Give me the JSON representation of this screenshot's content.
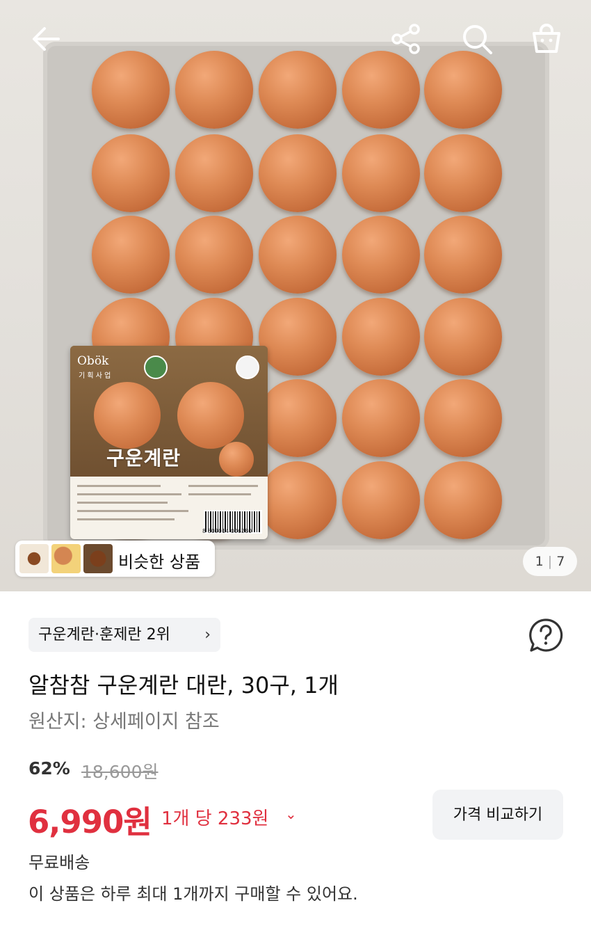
{
  "header": {
    "back_icon": "arrow-left-icon",
    "share_icon": "share-icon",
    "search_icon": "search-icon",
    "cart_icon": "shopping-bag-icon"
  },
  "gallery": {
    "current": "1",
    "total": "7",
    "similar_label": "비슷한 상품",
    "package": {
      "brand": "Obök",
      "brand_sub": "기 획 사 업",
      "title": "구운계란",
      "barcode": "8 809014 006280"
    }
  },
  "product": {
    "rank_badge": "구운계란·훈제란 2위",
    "rank_chevron": "›",
    "title": "알참참 구운계란 대란, 30구, 1개",
    "origin": "원산지: 상세페이지 참조",
    "discount": "62%",
    "original_price": "18,600원",
    "price": "6,990원",
    "unit_price": "1개 당 233원",
    "unit_chevron": "⌄",
    "compare_button": "가격 비교하기",
    "shipping": "무료배송",
    "purchase_limit": "이 상품은 하루 최대 1개까지 구매할 수 있어요."
  },
  "colors": {
    "price_red": "#e0303f",
    "chip_bg": "#f2f3f5",
    "egg": "#de8a55"
  }
}
